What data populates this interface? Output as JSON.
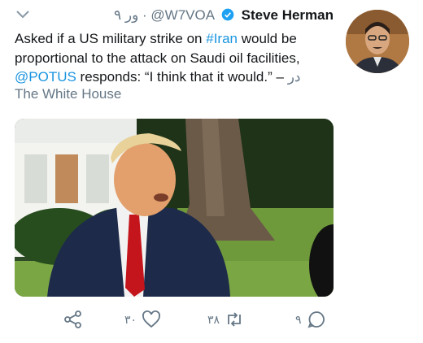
{
  "tweet": {
    "author_name": "Steve Herman",
    "author_handle": "@W7VOA",
    "time_ago": "۹ ور",
    "text_part1": "Asked if a US military strike on ",
    "hashtag": "#Iran",
    "text_part2": " would be proportional to the attack on Saudi oil facilities, ",
    "mention": "@POTUS",
    "text_part3": " responds: “I think that it would.” – ",
    "text_time": "در",
    "location": "The White House"
  },
  "actions": {
    "like_count": "۳۰",
    "retweet_count": "۳۸",
    "reply_count": "۹"
  },
  "colors": {
    "link": "#1b95e0",
    "muted": "#657786",
    "verified": "#1da1f2"
  },
  "icons": [
    "chevron-down-icon",
    "verified-icon",
    "share-icon",
    "heart-icon",
    "retweet-icon",
    "reply-icon"
  ]
}
